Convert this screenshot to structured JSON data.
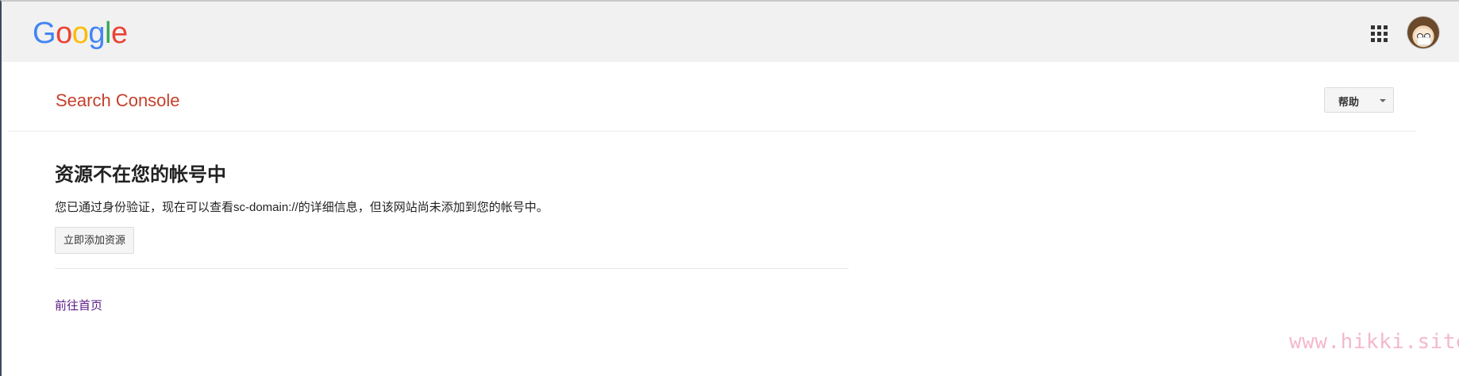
{
  "google_bar": {
    "logo_letters": [
      {
        "char": "G",
        "color": "#4285F4"
      },
      {
        "char": "o",
        "color": "#EA4335"
      },
      {
        "char": "o",
        "color": "#FBBC05"
      },
      {
        "char": "g",
        "color": "#4285F4"
      },
      {
        "char": "l",
        "color": "#34A853"
      },
      {
        "char": "e",
        "color": "#EA4335"
      }
    ],
    "apps_icon": "apps-grid-icon",
    "avatar_icon": "user-avatar"
  },
  "header": {
    "title": "Search Console",
    "title_color": "#C5402A",
    "help_label": "帮助"
  },
  "main": {
    "heading": "资源不在您的帐号中",
    "message": "您已通过身份验证，现在可以查看sc-domain://的详细信息，但该网站尚未添加到您的帐号中。",
    "add_button_label": "立即添加资源",
    "home_link": "前往首页",
    "link_color": "#5B1A86"
  },
  "watermark": {
    "text": "www.hikki.site"
  }
}
